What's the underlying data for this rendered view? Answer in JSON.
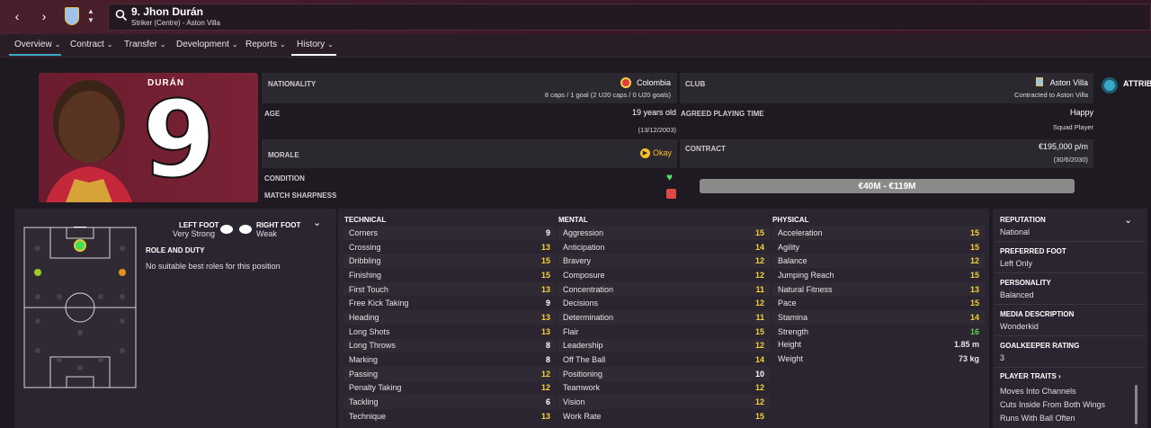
{
  "header": {
    "title": "9. Jhon Durán",
    "subtitle": "Striker (Centre) - Aston Villa",
    "back_icon": "‹",
    "forward_icon": "›"
  },
  "tabs": [
    {
      "label": "Overview"
    },
    {
      "label": "Contract"
    },
    {
      "label": "Transfer"
    },
    {
      "label": "Development"
    },
    {
      "label": "Reports"
    },
    {
      "label": "History"
    }
  ],
  "photo": {
    "shirt_name": "DURÁN",
    "shirt_number": "9"
  },
  "info": {
    "nationality_label": "NATIONALITY",
    "nationality_value": "Colombia",
    "nationality_sub": "8 caps / 1 goal (2 U20 caps / 0 U20 goals)",
    "club_label": "CLUB",
    "club_value": "Aston Villa",
    "club_sub": "Contracted to Aston Villa",
    "age_label": "AGE",
    "age_value": "19 years old",
    "age_sub": "(13/12/2003)",
    "playing_time_label": "AGREED PLAYING TIME",
    "playing_time_value": "Happy",
    "playing_time_sub": "Squad Player",
    "morale_label": "MORALE",
    "morale_value": "Okay",
    "contract_label": "CONTRACT",
    "contract_value": "€195,000 p/m",
    "contract_sub": "(30/6/2030)",
    "condition_label": "CONDITION",
    "sharpness_label": "MATCH SHARPNESS",
    "value_range": "€40M - €119M",
    "attrib_label": "ATTRIB"
  },
  "left_panel": {
    "left_foot_label": "LEFT FOOT",
    "left_foot_value": "Very Strong",
    "right_foot_label": "RIGHT FOOT",
    "right_foot_value": "Weak",
    "role_label": "ROLE AND DUTY",
    "role_value": "No suitable best roles for this position"
  },
  "technical": {
    "title": "TECHNICAL",
    "rows": [
      {
        "name": "Corners",
        "value": "9"
      },
      {
        "name": "Crossing",
        "value": "13"
      },
      {
        "name": "Dribbling",
        "value": "15"
      },
      {
        "name": "Finishing",
        "value": "15"
      },
      {
        "name": "First Touch",
        "value": "13"
      },
      {
        "name": "Free Kick Taking",
        "value": "9"
      },
      {
        "name": "Heading",
        "value": "13"
      },
      {
        "name": "Long Shots",
        "value": "13"
      },
      {
        "name": "Long Throws",
        "value": "8"
      },
      {
        "name": "Marking",
        "value": "8"
      },
      {
        "name": "Passing",
        "value": "12"
      },
      {
        "name": "Penalty Taking",
        "value": "12"
      },
      {
        "name": "Tackling",
        "value": "6"
      },
      {
        "name": "Technique",
        "value": "13"
      }
    ]
  },
  "mental": {
    "title": "MENTAL",
    "rows": [
      {
        "name": "Aggression",
        "value": "15"
      },
      {
        "name": "Anticipation",
        "value": "14"
      },
      {
        "name": "Bravery",
        "value": "12"
      },
      {
        "name": "Composure",
        "value": "12"
      },
      {
        "name": "Concentration",
        "value": "11"
      },
      {
        "name": "Decisions",
        "value": "12"
      },
      {
        "name": "Determination",
        "value": "11"
      },
      {
        "name": "Flair",
        "value": "15"
      },
      {
        "name": "Leadership",
        "value": "12"
      },
      {
        "name": "Off The Ball",
        "value": "14"
      },
      {
        "name": "Positioning",
        "value": "10"
      },
      {
        "name": "Teamwork",
        "value": "12"
      },
      {
        "name": "Vision",
        "value": "12"
      },
      {
        "name": "Work Rate",
        "value": "15"
      }
    ]
  },
  "physical": {
    "title": "PHYSICAL",
    "rows": [
      {
        "name": "Acceleration",
        "value": "15"
      },
      {
        "name": "Agility",
        "value": "15"
      },
      {
        "name": "Balance",
        "value": "12"
      },
      {
        "name": "Jumping Reach",
        "value": "15"
      },
      {
        "name": "Natural Fitness",
        "value": "13"
      },
      {
        "name": "Pace",
        "value": "15"
      },
      {
        "name": "Stamina",
        "value": "14"
      },
      {
        "name": "Strength",
        "value": "16"
      }
    ],
    "height_label": "Height",
    "height_value": "1.85 m",
    "weight_label": "Weight",
    "weight_value": "73 kg"
  },
  "side": {
    "reputation_label": "REPUTATION",
    "reputation_value": "National",
    "foot_label": "PREFERRED FOOT",
    "foot_value": "Left Only",
    "personality_label": "PERSONALITY",
    "personality_value": "Balanced",
    "media_label": "MEDIA DESCRIPTION",
    "media_value": "Wonderkid",
    "gk_label": "GOALKEEPER RATING",
    "gk_value": "3",
    "traits_label": "PLAYER TRAITS ›",
    "traits": [
      "Moves Into Channels",
      "Cuts Inside From Both Wings",
      "Runs With Ball Often"
    ]
  },
  "colors": {
    "accent": "#3ba8c8",
    "good": "#f5d23a",
    "great": "#5fd14d",
    "shirt": "#7a2236"
  }
}
